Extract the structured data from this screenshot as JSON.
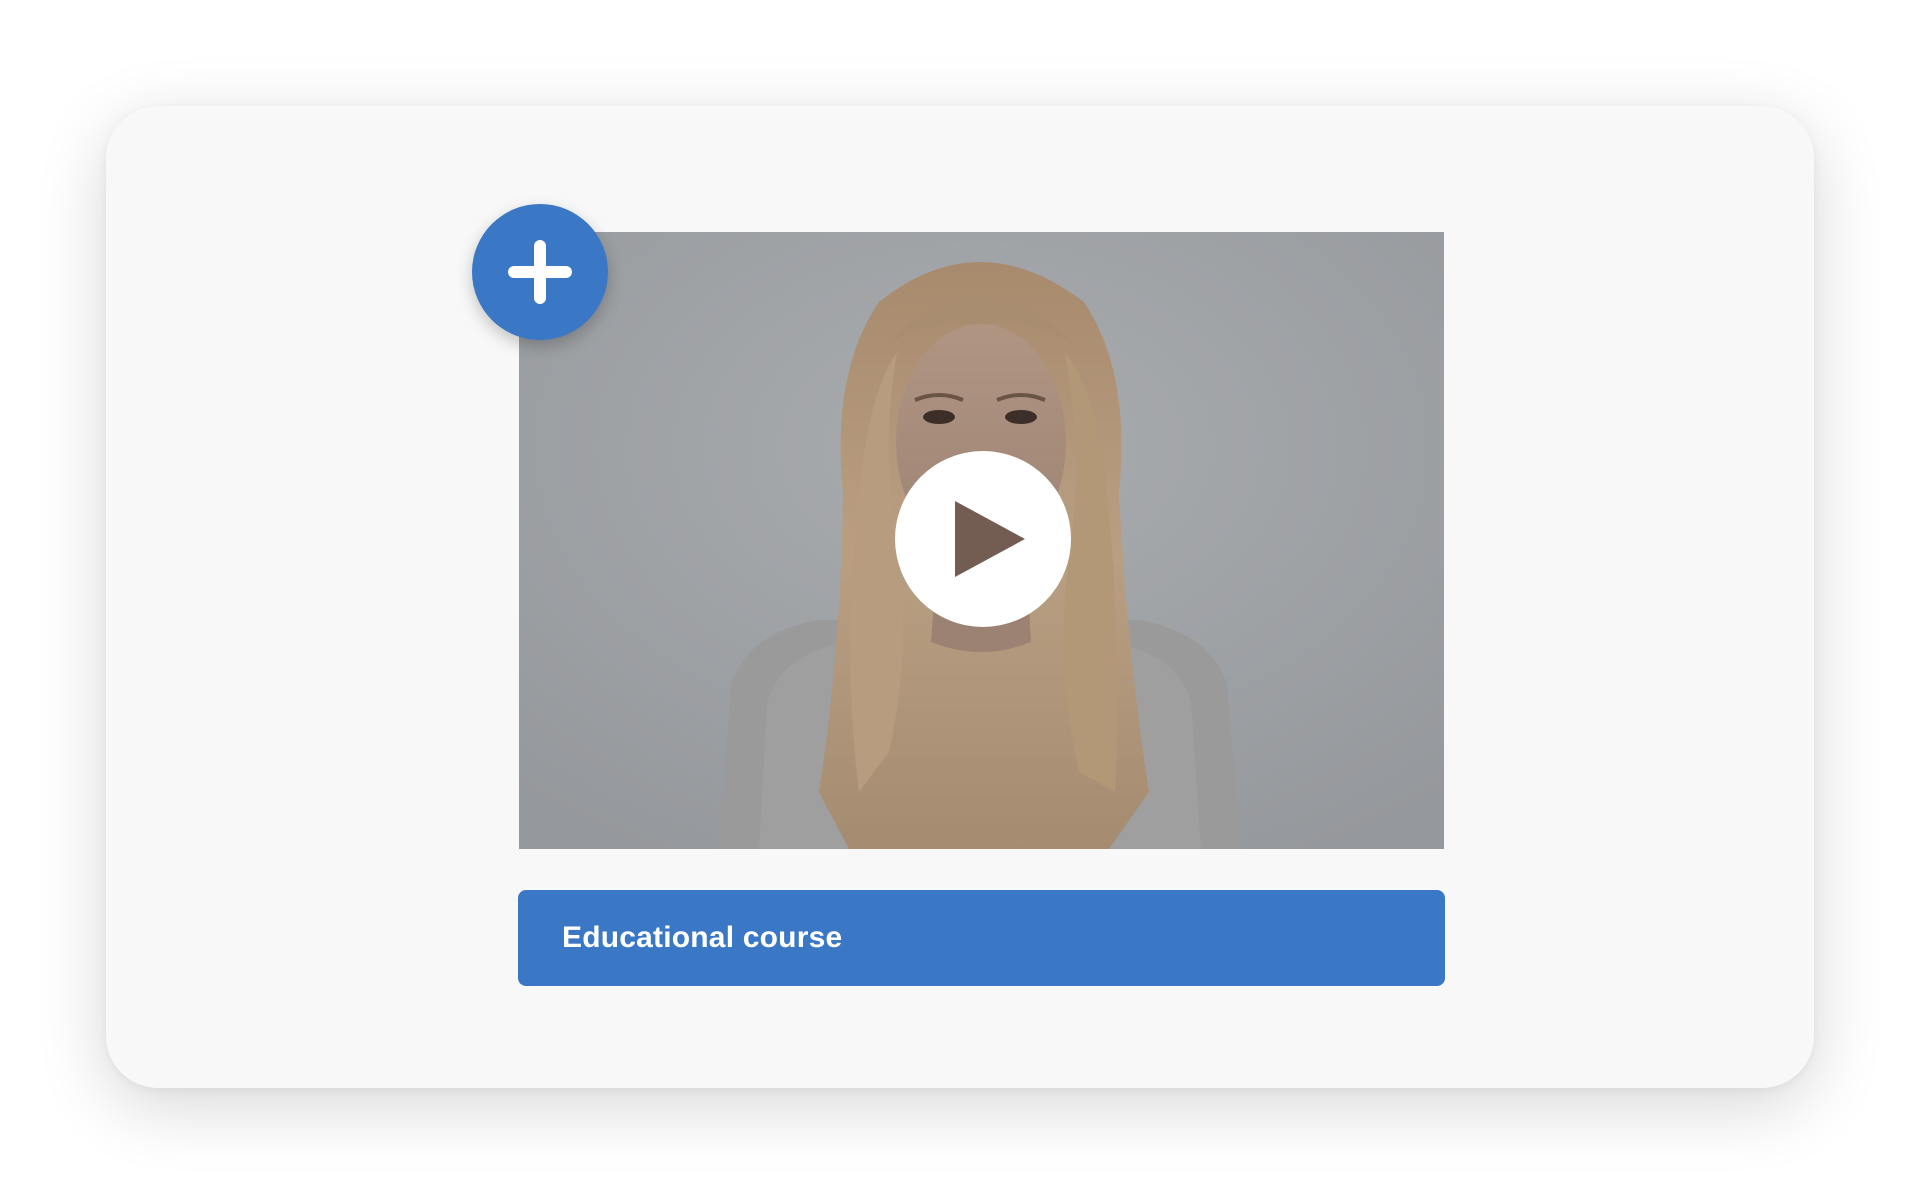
{
  "colors": {
    "accent": "#3a78c6",
    "card_background": "#f8f8f8",
    "video_backdrop": "#9ea1a5"
  },
  "video": {
    "thumbnail": "woman-portrait",
    "play_icon": "play-icon"
  },
  "add_button": {
    "icon": "plus-icon"
  },
  "course": {
    "title": "Educational course"
  }
}
